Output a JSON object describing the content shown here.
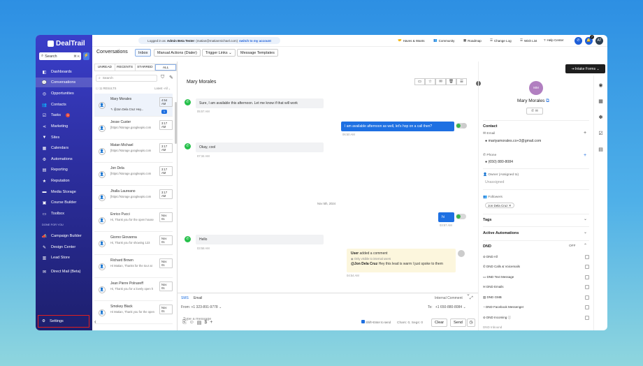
{
  "app": {
    "logo": "DealTrail",
    "search_placeholder": "Search",
    "search_kbd": "⌘ K"
  },
  "sidebar": {
    "items": [
      {
        "label": "Dashboards",
        "icon": "dashboard-icon"
      },
      {
        "label": "Conversations",
        "icon": "chat-icon",
        "active": true
      },
      {
        "label": "Opportunities",
        "icon": "target-icon"
      },
      {
        "label": "Contacts",
        "icon": "contacts-icon"
      },
      {
        "label": "Tasks",
        "icon": "tasks-icon",
        "badge": "1"
      },
      {
        "label": "Marketing",
        "icon": "share-icon"
      },
      {
        "label": "Sites",
        "icon": "sites-icon"
      },
      {
        "label": "Calendars",
        "icon": "calendar-icon"
      },
      {
        "label": "Automations",
        "icon": "automation-icon"
      },
      {
        "label": "Reporting",
        "icon": "chart-icon"
      },
      {
        "label": "Reputation",
        "icon": "star-icon"
      },
      {
        "label": "Media Storage",
        "icon": "folder-icon"
      },
      {
        "label": "Course Builder",
        "icon": "course-icon"
      },
      {
        "label": "Toolbox",
        "icon": "toolbox-icon"
      }
    ],
    "section_label": "DONE FOR YOU",
    "items2": [
      {
        "label": "Campaign Builder",
        "icon": "megaphone-icon"
      },
      {
        "label": "Design Center",
        "icon": "brush-icon"
      },
      {
        "label": "Lead Store",
        "icon": "store-icon"
      },
      {
        "label": "Direct Mail (Beta)",
        "icon": "mail-icon"
      }
    ],
    "settings": "Settings"
  },
  "topbar": {
    "logged_prefix": "Logged in as",
    "logged_user": "Admin Beta Tester",
    "logged_email": "(matian@matianmichael.com)",
    "switch": "switch to my account",
    "links": [
      "Haves & Wants",
      "Community",
      "Roadmap",
      "Change Log",
      "Wish List",
      "Help Center"
    ],
    "notif_count": "7",
    "avatar": "AT"
  },
  "conv": {
    "title": "Conversations",
    "tabs": [
      "Inbox",
      "Manual Actions (Dialer)",
      "Trigger Links",
      "Message Templates"
    ],
    "intake": "Intake Forms"
  },
  "list": {
    "filters": [
      "UNREAD",
      "RECENTS",
      "STARRED",
      "ALL"
    ],
    "search_placeholder": "Search",
    "results": "11 RESULTS",
    "sort": "Latest -All",
    "rows": [
      {
        "name": "Mary Morales",
        "preview": "@Jon Dela Cruz Hey...",
        "date": "4:54 AM",
        "count": "1"
      },
      {
        "name": "Jesse Custer",
        "preview": "[https://storage.googleapis.com",
        "date": "3:17 AM"
      },
      {
        "name": "Matan Michael",
        "preview": "[https://storage.googleapis.com",
        "date": "3:17 AM"
      },
      {
        "name": "Jon Dela",
        "preview": "[https://storage.googleapis.com",
        "date": "3:17 AM"
      },
      {
        "name": "Jhalla Laureano",
        "preview": "[https://storage.googleapis.com",
        "date": "3:17 AM"
      },
      {
        "name": "Enrico Pucci",
        "preview": "Hi, Thank you for the open house",
        "date": "Nov 01"
      },
      {
        "name": "Giorno Giovanna",
        "preview": "Hi, Thank you for showing 123",
        "date": "Nov 01"
      },
      {
        "name": "Richard Brown",
        "preview": "Hi Matian, Thanks for the tour at",
        "date": "Nov 01"
      },
      {
        "name": "Jean Pierre Polnareff",
        "preview": "Hi, Thank you for a lovely open h",
        "date": "Nov 01"
      },
      {
        "name": "Smokey Black",
        "preview": "Hi Matian, Thank you for the open",
        "date": "Nov 01"
      }
    ]
  },
  "chat": {
    "contact": "Mary Morales",
    "messages": [
      {
        "text": "Sure, I am available this afternoon. Let me know if that will work",
        "time": "05:57 AM"
      },
      {
        "text": "I am available afternoon as well, let's hop on a call then?",
        "time": "06:50 AM"
      },
      {
        "text": "Okay, cool",
        "time": "07:34 AM"
      },
      {
        "text": "hi",
        "time": "03:57 AM"
      },
      {
        "text": "Hello",
        "time": "03:58 AM"
      }
    ],
    "day_sep": "Nov 5th, 2024",
    "comment": {
      "user": "User",
      "action": "added a comment",
      "sub": "Only visible to internal users",
      "mention": "@Jon Dela Cruz",
      "body": "Hey this lead is warm I just spoke to them",
      "time": "04:54 AM"
    },
    "compose": {
      "tab_sms": "SMS",
      "tab_email": "Email",
      "internal": "Internal Comment",
      "from_label": "From:",
      "from": "+1 323-891-9778",
      "to_label": "To:",
      "to": "+1 650-880-8084",
      "placeholder": "Type a message",
      "shift": "Shift+Enter to send",
      "chars": "Chars: 0, Segs: 0",
      "clear": "Clear",
      "send": "Send"
    }
  },
  "right": {
    "initials": "MM",
    "name": "Mary Morales",
    "contact": "Contact",
    "email_label": "Email",
    "email": "mariyamorales.co+3@gmail.com",
    "phone_label": "Phone",
    "phone": "(650) 880-8084",
    "owner_label": "Owner (Assigned to)",
    "owner": "Unassigned",
    "followers_label": "Followers",
    "follower": "Jon Dela Cruz",
    "tags": "Tags",
    "active_automations": "Active Automations",
    "dnd": "DND",
    "dnd_state": "OFF",
    "dnd_items": [
      "DND All",
      "DND Calls & Voicemails",
      "DND Text Message",
      "DND Emails",
      "DND GMB",
      "DND Facebook Messenger",
      "DND Incoming"
    ],
    "extra": "DND Inbound"
  }
}
